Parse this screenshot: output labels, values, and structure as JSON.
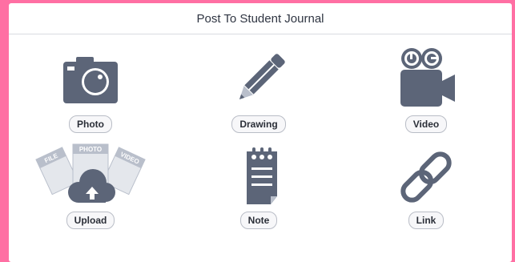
{
  "dialog": {
    "title": "Post To Student Journal"
  },
  "options": [
    {
      "label": "Photo",
      "icon": "camera-icon"
    },
    {
      "label": "Drawing",
      "icon": "pencil-icon"
    },
    {
      "label": "Video",
      "icon": "video-camera-icon"
    },
    {
      "label": "Upload",
      "icon": "upload-cloud-icon"
    },
    {
      "label": "Note",
      "icon": "notepad-icon"
    },
    {
      "label": "Link",
      "icon": "link-icon"
    }
  ],
  "upload_cards": {
    "file": "FILE",
    "photo": "PHOTO",
    "video": "VIDEO"
  },
  "colors": {
    "icon": "#5c6578",
    "icon_light": "#b9bfcb",
    "frame": "#ff6fa3"
  }
}
